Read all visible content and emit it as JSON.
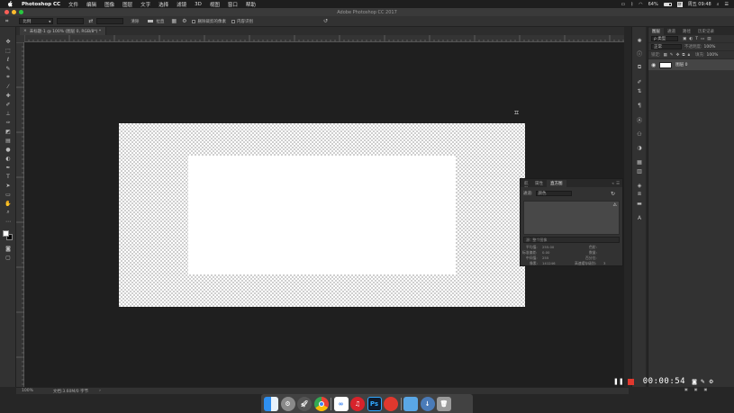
{
  "menubar": {
    "app_name": "Photoshop CC",
    "items": [
      "文件",
      "编辑",
      "图像",
      "图层",
      "文字",
      "选择",
      "滤镜",
      "3D",
      "视图",
      "窗口",
      "帮助"
    ],
    "battery": "64%",
    "clock": "周五 09:48"
  },
  "window": {
    "title": "Adobe Photoshop CC 2017"
  },
  "options": {
    "style_label": "比例",
    "clear_label": "清除",
    "straighten_label": "拉直",
    "delete_cropped_label": "删除裁剪的像素",
    "content_aware_label": "内容识别"
  },
  "document": {
    "tab_label": "未标题-1 @ 100% (图层 0, RGB/8*) *",
    "zoom": "100%",
    "doc_info": "文档:3.60M/0 字节"
  },
  "layers_panel": {
    "tabs": [
      "图层",
      "通道",
      "路径",
      "历史记录"
    ],
    "kind_label": "ρ 类型",
    "blend_mode": "正常",
    "opacity_label": "不透明度:",
    "opacity_value": "100%",
    "lock_label": "锁定:",
    "fill_label": "填充:",
    "fill_value": "100%",
    "layer_name": "图层 0"
  },
  "histogram_panel": {
    "tabs": [
      "导航器",
      "属性",
      "直方图"
    ],
    "channel_label": "通道:",
    "channel_value": "颜色",
    "source_label": "源:",
    "source_value": "整个图像",
    "stats": {
      "mean_label": "平均值:",
      "mean": "255.00",
      "stddev_label": "标准偏差:",
      "stddev": "0.00",
      "median_label": "中间值:",
      "median": "255",
      "pixels_label": "像素:",
      "pixels": "141246",
      "level_label": "色阶:",
      "count_label": "数量:",
      "percentile_label": "百分位:",
      "cache_label": "高速缓存级别:",
      "cache": "3"
    }
  },
  "recording": {
    "timer": "00:00:54"
  },
  "colors": {
    "menubar_bg": "#1e1e1e",
    "panel_bg": "#323232",
    "workspace_bg": "#1f1f1f",
    "rec_red": "#e0382e"
  },
  "dock": {
    "apps": [
      "finder-icon",
      "system-preferences-icon",
      "launchpad-icon",
      "chrome-icon",
      "baidu-netdisk-icon",
      "netease-music-icon",
      "photoshop-icon",
      "recorder-icon",
      "folder-icon",
      "trash-icon"
    ],
    "ps_label": "Ps"
  }
}
